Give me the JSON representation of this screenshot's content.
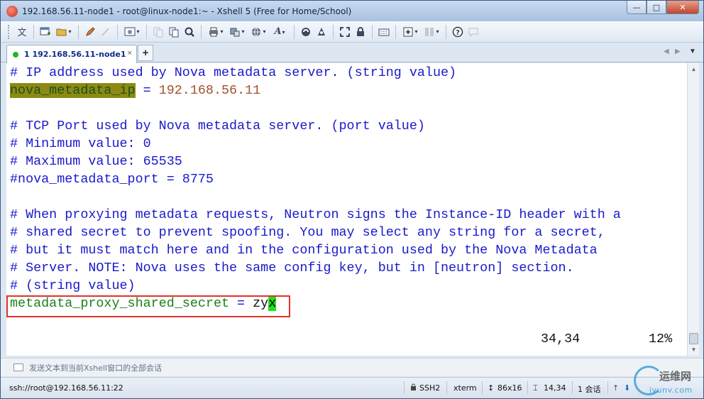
{
  "window": {
    "title": "192.168.56.11-node1 - root@linux-node1:~ - Xshell 5 (Free for Home/School)",
    "controls": [
      "—",
      "□",
      "✕"
    ]
  },
  "toolbar": {
    "icons": [
      "language-icon",
      "new-session-icon",
      "open-folder-icon",
      "edit-icon",
      "reconnect-icon",
      "properties-icon",
      "copy-icon",
      "paste-icon",
      "find-icon",
      "print-icon",
      "transfer-icon",
      "globe-icon",
      "font-icon",
      "xftp-icon",
      "xmanager-icon",
      "fullscreen-icon",
      "lock-icon",
      "keyboard-icon",
      "new-tab-icon",
      "layout-icon",
      "help-icon",
      "chat-icon"
    ],
    "language_glyph": "文"
  },
  "tabs": [
    {
      "label": "1 192.168.56.11-node1",
      "status_color": "#27b52b",
      "close": "×"
    }
  ],
  "tab_add": "+",
  "tab_nav": {
    "prev": "◀",
    "next": "▶",
    "menu": "▼"
  },
  "terminal": {
    "lines": [
      {
        "type": "comment",
        "text": "# IP address used by Nova metadata server. (string value)"
      },
      {
        "type": "kv",
        "key": "nova_metadata_ip",
        "sep": " = ",
        "value": "192.168.56.11"
      },
      {
        "type": "blank",
        "text": ""
      },
      {
        "type": "comment",
        "text": "# TCP Port used by Nova metadata server. (port value)"
      },
      {
        "type": "comment",
        "text": "# Minimum value: 0"
      },
      {
        "type": "comment",
        "text": "# Maximum value: 65535"
      },
      {
        "type": "comment",
        "text": "#nova_metadata_port = 8775"
      },
      {
        "type": "blank",
        "text": ""
      },
      {
        "type": "comment",
        "text": "# When proxying metadata requests, Neutron signs the Instance-ID header with a"
      },
      {
        "type": "comment",
        "text": "# shared secret to prevent spoofing. You may select any string for a secret,"
      },
      {
        "type": "comment",
        "text": "# but it must match here and in the configuration used by the Nova Metadata"
      },
      {
        "type": "comment",
        "text": "# Server. NOTE: Nova uses the same config key, but in [neutron] section."
      },
      {
        "type": "comment",
        "text": "# (string value)"
      },
      {
        "type": "edit",
        "key": "metadata_proxy_shared_secret",
        "sep": " = ",
        "value": "zy",
        "cursor_char": "x"
      }
    ],
    "cursor_position": "34,34",
    "scroll_percent": "12%"
  },
  "compose_bar": {
    "text": "发送文本到当前Xshell窗口的全部会话"
  },
  "statusbar": {
    "connection": "ssh://root@192.168.56.11:22",
    "protocol": "SSH2",
    "terminal_type": "xterm",
    "size": "86x16",
    "cursor": "14,34",
    "sessions": "1 会话"
  },
  "watermark": {
    "line1": "运维网",
    "line2": "iyunv.com"
  }
}
